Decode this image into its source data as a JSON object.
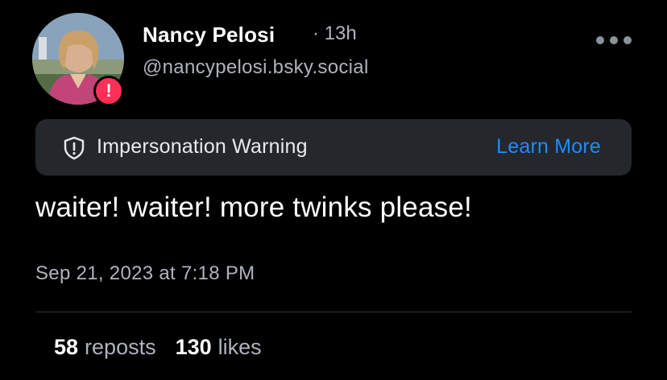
{
  "post": {
    "author": {
      "display_name": "Nancy Pelosi",
      "time_ago": "13h",
      "separator": "·",
      "handle": "@nancypelosi.bsky.social",
      "badge": "!"
    },
    "warning": {
      "icon": "shield-exclamation-icon",
      "text": "Impersonation Warning",
      "action": "Learn More"
    },
    "text": "waiter! waiter! more twinks please!",
    "timestamp": "Sep 21, 2023 at 7:18 PM",
    "stats": {
      "reposts_count": "58",
      "reposts_label": "reposts",
      "likes_count": "130",
      "likes_label": "likes"
    }
  },
  "colors": {
    "background": "#000000",
    "muted_text": "#aeb4bd",
    "warning_bg": "#24272c",
    "link": "#1f8bff",
    "alert": "#ff2f56"
  }
}
